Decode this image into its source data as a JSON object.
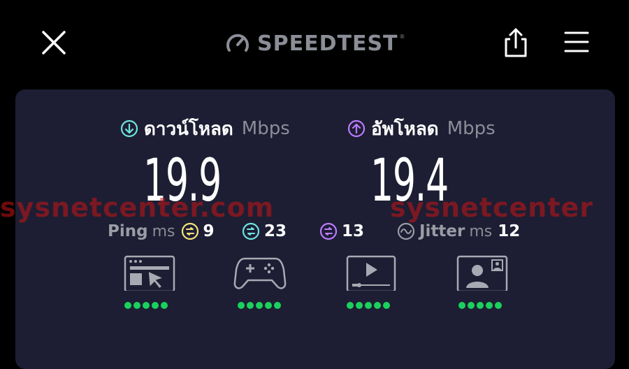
{
  "header": {
    "logo_text": "SPEEDTEST",
    "logo_reg": "®",
    "close_icon": "close-icon",
    "share_icon": "share-icon",
    "menu_icon": "hamburger-menu-icon"
  },
  "download": {
    "label": "ดาวน์โหลด",
    "unit": "Mbps",
    "value": "19.9",
    "icon_color": "#6fe3e0"
  },
  "upload": {
    "label": "อัพโหลด",
    "unit": "Mbps",
    "value": "19.4",
    "icon_color": "#bc7bff"
  },
  "ping": {
    "label": "Ping",
    "unit": "ms",
    "idle": "9",
    "download": "23",
    "upload": "13",
    "idle_color": "#f3e37c",
    "download_color": "#6fe3e0",
    "upload_color": "#bc7bff"
  },
  "jitter": {
    "label": "Jitter",
    "unit": "ms",
    "value": "12"
  },
  "watermark": {
    "left": "sysnetcenter.com",
    "right": "sysnetcenter"
  },
  "experience": [
    {
      "name": "web-browsing",
      "icon": "browser-cursor-icon",
      "rating": 5
    },
    {
      "name": "gaming",
      "icon": "gamepad-icon",
      "rating": 5
    },
    {
      "name": "video-streaming",
      "icon": "video-player-icon",
      "rating": 5
    },
    {
      "name": "video-chat",
      "icon": "video-call-icon",
      "rating": 5
    }
  ],
  "colors": {
    "background": "#000000",
    "card": "#1d1e33",
    "rating_dot": "#1bd15d",
    "muted_text": "#8b8e97"
  }
}
